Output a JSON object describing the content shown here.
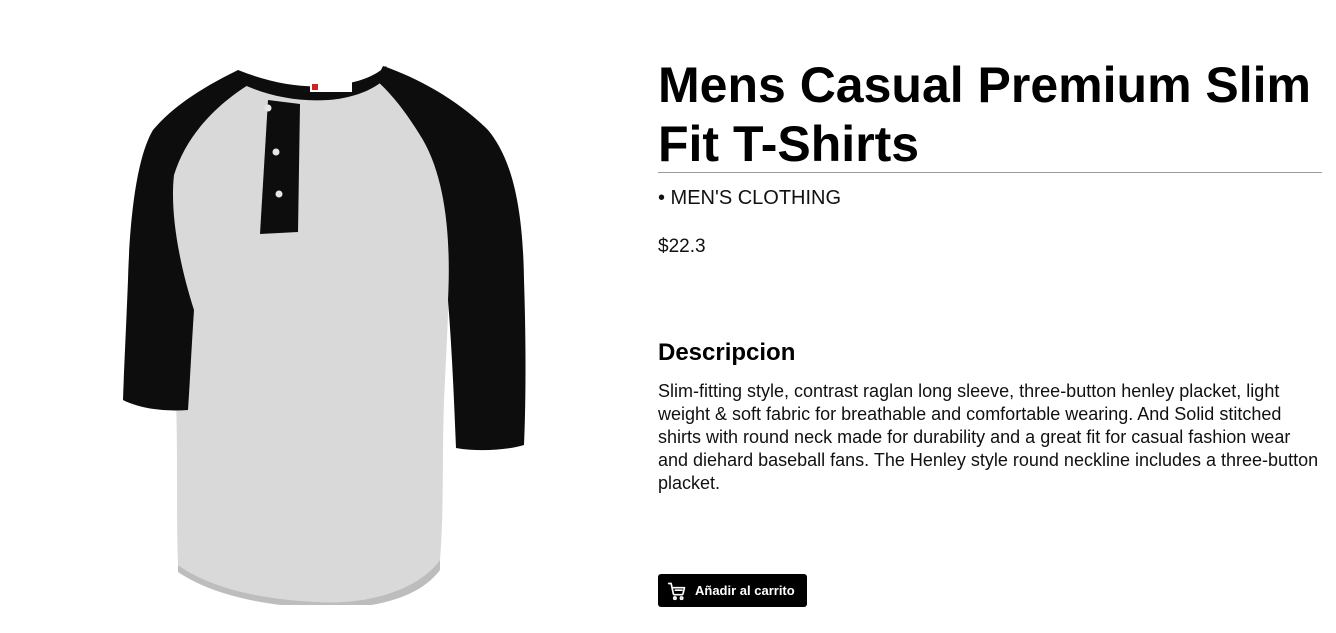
{
  "product": {
    "title": "Mens Casual Premium Slim Fit T-Shirts",
    "category": "• MEN'S CLOTHING",
    "price": "$22.3",
    "image_alt": "shirt-image"
  },
  "description": {
    "heading": "Descripcion",
    "text": "Slim-fitting style, contrast raglan long sleeve, three-button henley placket, light weight & soft fabric for breathable and comfortable wearing. And Solid stitched shirts with round neck made for durability and a great fit for casual fashion wear and diehard baseball fans. The Henley style round neckline includes a three-button placket."
  },
  "actions": {
    "add_to_cart_label": "Añadir al carrito",
    "add_to_cart_icon": "cart-icon"
  },
  "colors": {
    "button_background": "#000000",
    "button_text": "#ffffff",
    "divider": "#9a9a9a"
  }
}
